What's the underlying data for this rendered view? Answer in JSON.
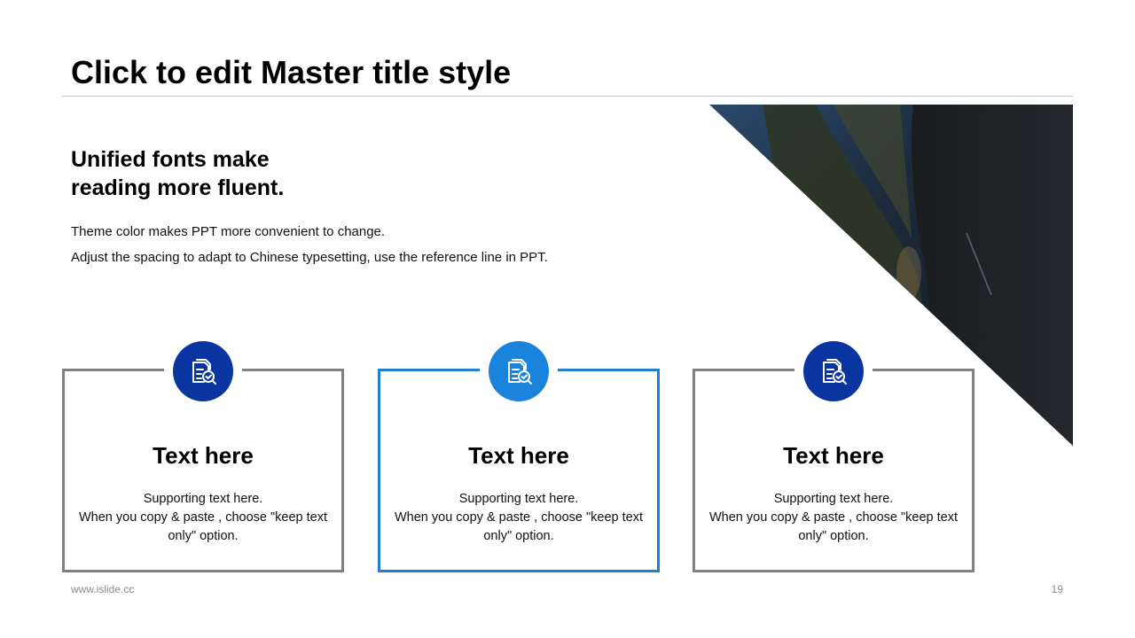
{
  "slide": {
    "title": "Click to edit Master title style",
    "heading_line1": "Unified fonts make",
    "heading_line2": "reading more fluent.",
    "body_line1": "Theme color makes PPT more convenient to change.",
    "body_line2": "Adjust the spacing to adapt to Chinese typesetting, use the reference line in PPT."
  },
  "cards": [
    {
      "icon": "document-search-icon",
      "title": "Text here",
      "line1": "Supporting  text here.",
      "line2": "When  you copy & paste , choose \"keep text only\" option.",
      "accent": "#0a34a0",
      "border": "#808080"
    },
    {
      "icon": "document-search-icon",
      "title": "Text here",
      "line1": "Supporting  text here.",
      "line2": "When  you copy & paste , choose \"keep text only\" option.",
      "accent": "#1a84dd",
      "border": "#1f7fd1"
    },
    {
      "icon": "document-search-icon",
      "title": "Text here",
      "line1": "Supporting  text here.",
      "line2": "When  you copy & paste , choose \"keep text only\" option.",
      "accent": "#0a34a0",
      "border": "#808080"
    }
  ],
  "footer": {
    "url": "www.islide.cc",
    "page_number": "19"
  },
  "colors": {
    "dark_blue": "#0a34a0",
    "light_blue": "#1a84dd",
    "card_border_gray": "#808080",
    "rule_gray": "#c8c8c8"
  }
}
